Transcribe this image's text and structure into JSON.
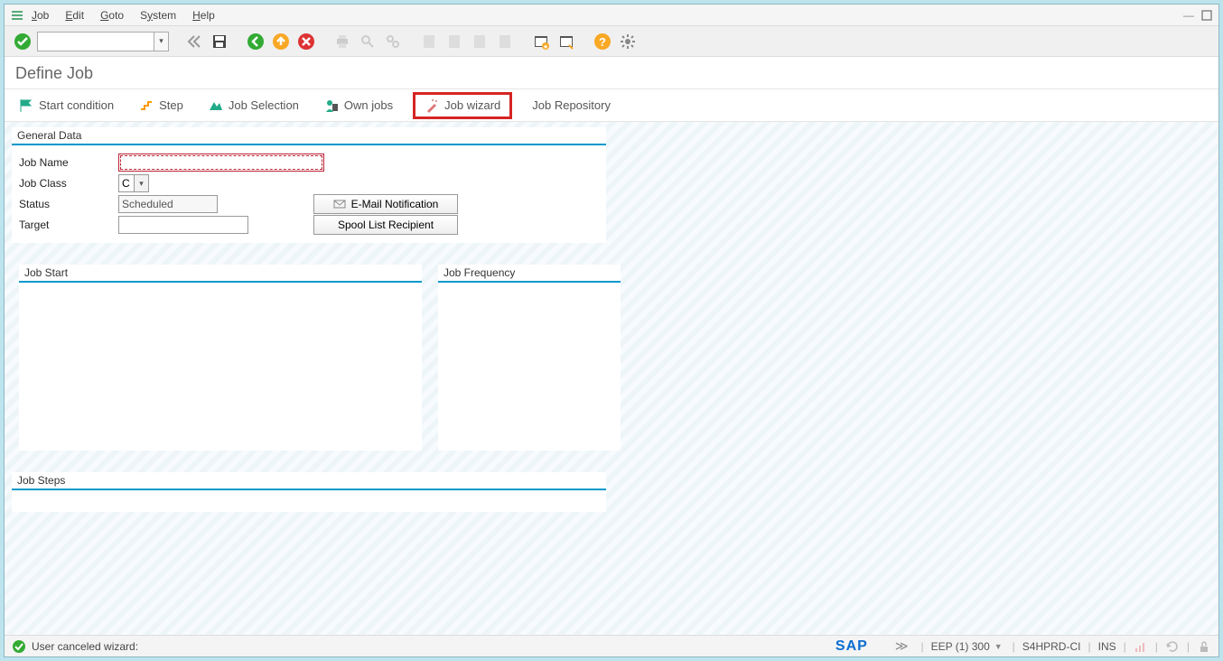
{
  "menubar": {
    "items": [
      "Job",
      "Edit",
      "Goto",
      "System",
      "Help"
    ]
  },
  "title": "Define Job",
  "actions": {
    "start_condition": "Start condition",
    "step": "Step",
    "job_selection": "Job Selection",
    "own_jobs": "Own jobs",
    "job_wizard": "Job wizard",
    "job_repository": "Job Repository"
  },
  "general_data": {
    "title": "General Data",
    "job_name_label": "Job Name",
    "job_name_value": "",
    "job_class_label": "Job Class",
    "job_class_value": "C",
    "status_label": "Status",
    "status_value": "Scheduled",
    "target_label": "Target",
    "target_value": "",
    "email_btn": "E-Mail Notification",
    "spool_btn": "Spool List Recipient"
  },
  "job_start": {
    "title": "Job Start"
  },
  "job_frequency": {
    "title": "Job Frequency"
  },
  "job_steps": {
    "title": "Job Steps"
  },
  "status": {
    "message": "User canceled wizard:",
    "system": "EEP (1) 300",
    "server": "S4HPRD-CI",
    "mode": "INS"
  }
}
